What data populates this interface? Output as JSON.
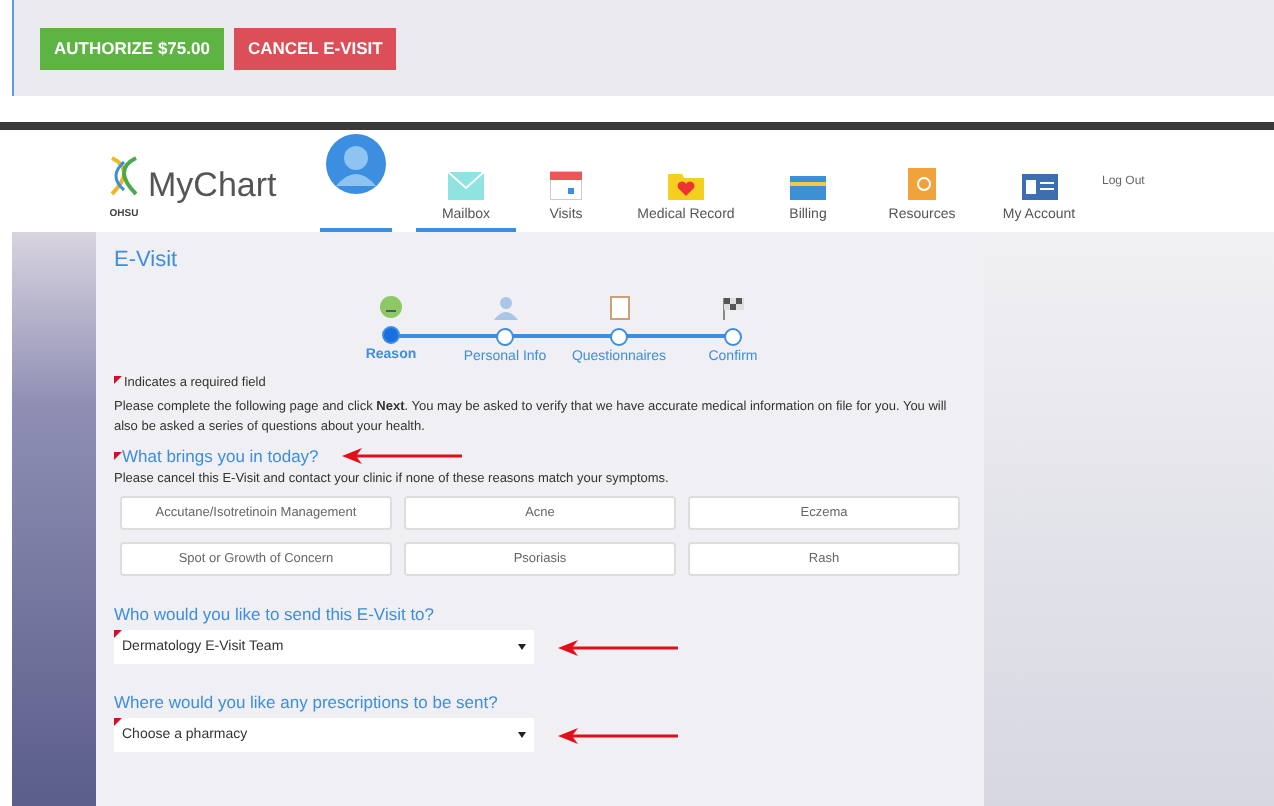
{
  "actions": [
    {
      "label": "AUTHORIZE $75.00",
      "kind": "confirm"
    },
    {
      "label": "CANCEL E-VISIT",
      "kind": "cancel"
    }
  ],
  "header": {
    "logo_text": "MyChart",
    "logo_sub": "OHSU",
    "avatar_selected": true,
    "nav": [
      {
        "label": "Mailbox",
        "selected": true
      },
      {
        "label": "Visits",
        "selected": false
      },
      {
        "label": "Medical Record",
        "selected": false
      },
      {
        "label": "Billing",
        "selected": false
      },
      {
        "label": "Resources",
        "selected": false
      },
      {
        "label": "My Account",
        "selected": false
      }
    ],
    "logout": "Log Out"
  },
  "page": {
    "title": "E-Visit",
    "steps": [
      {
        "label": "Reason",
        "selected": true
      },
      {
        "label": "Personal Info",
        "selected": false
      },
      {
        "label": "Questionnaires",
        "selected": false
      },
      {
        "label": "Confirm",
        "selected": false
      }
    ],
    "required_note": "Indicates a required field",
    "intro": "Please complete the following page and click **Next**. You may be asked to verify that we have accurate medical information on file for you. You will also be asked a series of questions about your health.",
    "reason_question": {
      "label": "What brings you in today?",
      "required": true
    },
    "reason_hint": "Please cancel this E-Visit and contact your clinic if none of these reasons match your symptoms.",
    "reasons": [
      {
        "label": "Accutane/Isotretinoin Management",
        "selected": false
      },
      {
        "label": "Acne",
        "selected": false
      },
      {
        "label": "Eczema",
        "selected": false
      },
      {
        "label": "Spot or Growth of Concern",
        "selected": false
      },
      {
        "label": "Psoriasis",
        "selected": false
      },
      {
        "label": "Rash",
        "selected": false
      }
    ],
    "selects": [
      {
        "label": "Who would you like to send this E-Visit to?",
        "value": "Dermatology E-Visit Team",
        "required": true
      },
      {
        "label": "Where would you like any prescriptions to be sent?",
        "value": "Choose a pharmacy",
        "required": true
      }
    ]
  }
}
